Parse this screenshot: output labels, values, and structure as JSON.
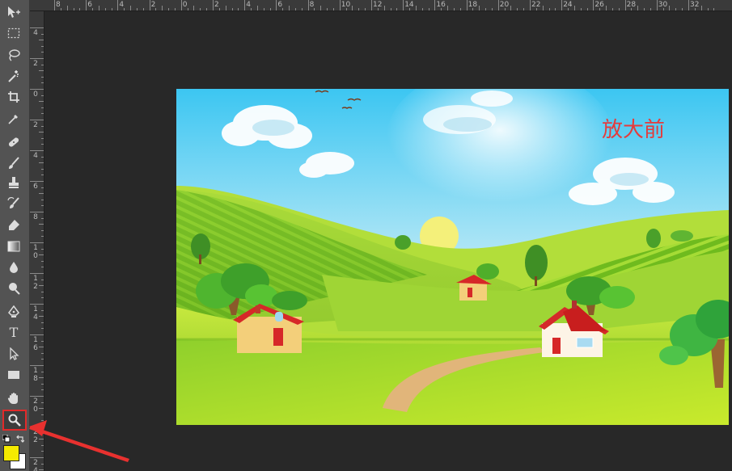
{
  "toolbar": {
    "tools": [
      {
        "name": "move-tool",
        "icon": "move-icon"
      },
      {
        "name": "marquee-tool",
        "icon": "marquee-icon"
      },
      {
        "name": "lasso-tool",
        "icon": "lasso-icon"
      },
      {
        "name": "magic-wand-tool",
        "icon": "magic-wand-icon"
      },
      {
        "name": "crop-tool",
        "icon": "crop-icon"
      },
      {
        "name": "eyedropper-tool",
        "icon": "eyedropper-icon"
      },
      {
        "name": "healing-brush-tool",
        "icon": "bandage-icon"
      },
      {
        "name": "brush-tool",
        "icon": "brush-icon"
      },
      {
        "name": "clone-stamp-tool",
        "icon": "stamp-icon"
      },
      {
        "name": "history-brush-tool",
        "icon": "history-brush-icon"
      },
      {
        "name": "eraser-tool",
        "icon": "eraser-icon"
      },
      {
        "name": "gradient-tool",
        "icon": "gradient-icon"
      },
      {
        "name": "blur-tool",
        "icon": "drop-icon"
      },
      {
        "name": "dodge-tool",
        "icon": "dodge-icon"
      },
      {
        "name": "pen-tool",
        "icon": "pen-icon"
      },
      {
        "name": "type-tool",
        "icon": "type-icon",
        "glyph": "T"
      },
      {
        "name": "path-selection-tool",
        "icon": "arrow-cursor-icon"
      },
      {
        "name": "rectangle-tool",
        "icon": "rectangle-icon"
      },
      {
        "name": "hand-tool",
        "icon": "hand-icon"
      },
      {
        "name": "zoom-tool",
        "icon": "magnifier-icon",
        "selected": true
      }
    ],
    "foreground_color": "#f5ea00",
    "background_color": "#ffffff"
  },
  "ruler_top": {
    "labels": [
      "8",
      "6",
      "4",
      "2",
      "0",
      "2",
      "4",
      "6",
      "8",
      "10",
      "12",
      "14",
      "16",
      "18",
      "20",
      "22",
      "24",
      "26",
      "28",
      "30",
      "32"
    ]
  },
  "ruler_left": {
    "labels": [
      [
        "4"
      ],
      [
        "2"
      ],
      [
        "0"
      ],
      [
        "2"
      ],
      [
        "4"
      ],
      [
        "6"
      ],
      [
        "8"
      ],
      [
        "1",
        "0"
      ],
      [
        "1",
        "2"
      ],
      [
        "1",
        "4"
      ],
      [
        "1",
        "6"
      ],
      [
        "1",
        "8"
      ],
      [
        "2",
        "0"
      ],
      [
        "2",
        "2"
      ],
      [
        "2",
        "4"
      ]
    ]
  },
  "canvas": {
    "overlay_text": "放大前",
    "overlay_color": "#e53b3b"
  },
  "annotation": {
    "highlight_color": "#e12a2a",
    "arrow_color": "#e8312f"
  }
}
